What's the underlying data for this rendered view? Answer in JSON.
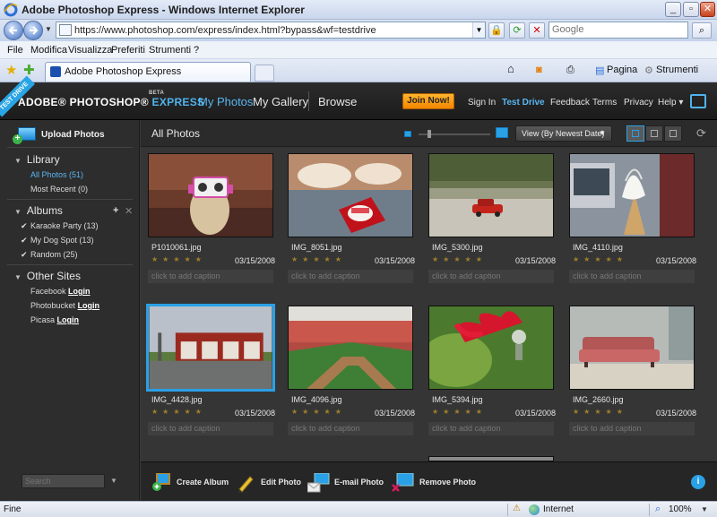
{
  "browser": {
    "window_title": "Adobe Photoshop Express - Windows Internet Explorer",
    "url": "https://www.photoshop.com/express/index.html?bypass&wf=testdrive",
    "search_placeholder": "Google",
    "menu": [
      "File",
      "Modifica",
      "Visualizza",
      "Preferiti",
      "Strumenti",
      "?"
    ],
    "tab_title": "Adobe Photoshop Express",
    "tools_right": [
      "Pagina",
      "Strumenti"
    ],
    "status_text": "Fine",
    "zone": "Internet",
    "zoom": "100%"
  },
  "app": {
    "ribbon": "TEST DRIVE",
    "brand": {
      "main": "ADOBE® PHOTOSHOP® ",
      "accent": "EXPRESS",
      "beta": "BETA"
    },
    "nav": [
      "My Photos",
      "My Gallery",
      "Browse"
    ],
    "join_label": "Join Now!",
    "top_links": [
      "Sign In",
      "Test Drive",
      "Feedback",
      "Terms",
      "Privacy",
      "Help ▾"
    ]
  },
  "sidebar": {
    "upload_label": "Upload Photos",
    "library_title": "Library",
    "library_items": [
      "All Photos (51)",
      "Most Recent (0)"
    ],
    "albums_title": "Albums",
    "albums": [
      "Karaoke Party (13)",
      "My Dog Spot (13)",
      "Random (25)"
    ],
    "other_title": "Other Sites",
    "sites": [
      {
        "name": "Facebook",
        "action": "Login"
      },
      {
        "name": "Photobucket",
        "action": "Login"
      },
      {
        "name": "Picasa",
        "action": "Login"
      }
    ],
    "search_placeholder": "Search"
  },
  "content": {
    "title": "All Photos",
    "sort_label": "View (By Newest Date)",
    "photos": [
      {
        "name": "P1010061.jpg",
        "date": "03/15/2008",
        "caption": "click to add caption"
      },
      {
        "name": "IMG_8051.jpg",
        "date": "03/15/2008",
        "caption": "click to add caption"
      },
      {
        "name": "IMG_5300.jpg",
        "date": "03/15/2008",
        "caption": "click to add caption"
      },
      {
        "name": "IMG_4110.jpg",
        "date": "03/15/2008",
        "caption": "click to add caption"
      },
      {
        "name": "IMG_4428.jpg",
        "date": "03/15/2008",
        "caption": "click to add caption"
      },
      {
        "name": "IMG_4096.jpg",
        "date": "03/15/2008",
        "caption": "click to add caption"
      },
      {
        "name": "IMG_5394.jpg",
        "date": "03/15/2008",
        "caption": "click to add caption"
      },
      {
        "name": "IMG_2660.jpg",
        "date": "03/15/2008",
        "caption": "click to add caption"
      }
    ],
    "stars": "★★★★★"
  },
  "actions": [
    "Create Album",
    "Edit Photo",
    "E-mail Photo",
    "Remove Photo"
  ],
  "colors": {
    "accent": "#2aa0e6",
    "join": "#f28600",
    "app_bg": "#3a3a3a"
  }
}
